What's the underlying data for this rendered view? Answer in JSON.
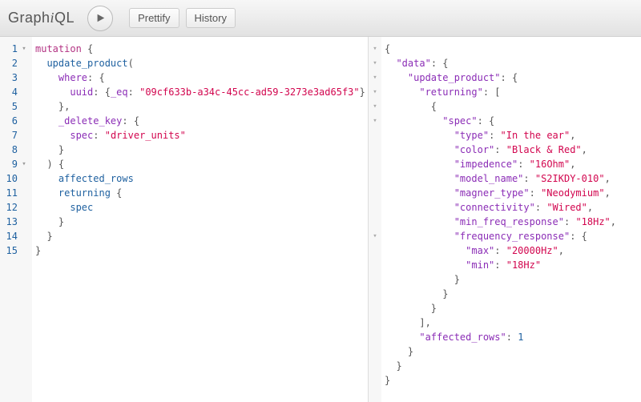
{
  "topbar": {
    "prettify_label": "Prettify",
    "history_label": "History"
  },
  "query": {
    "lines": [
      {
        "num": 1,
        "fold": true,
        "tokens": [
          [
            "kw",
            "mutation"
          ],
          [
            "plain",
            " "
          ],
          [
            "punc",
            "{"
          ]
        ]
      },
      {
        "num": 2,
        "fold": false,
        "tokens": [
          [
            "plain",
            "  "
          ],
          [
            "prop",
            "update_product"
          ],
          [
            "punc",
            "("
          ]
        ]
      },
      {
        "num": 3,
        "fold": false,
        "tokens": [
          [
            "plain",
            "    "
          ],
          [
            "attr",
            "where"
          ],
          [
            "punc",
            ": {"
          ]
        ]
      },
      {
        "num": 4,
        "fold": false,
        "tokens": [
          [
            "plain",
            "      "
          ],
          [
            "attr",
            "uuid"
          ],
          [
            "punc",
            ": {"
          ],
          [
            "attr",
            "_eq"
          ],
          [
            "punc",
            ": "
          ],
          [
            "str",
            "\"09cf633b-a34c-45cc-ad59-3273e3ad65f3\""
          ],
          [
            "punc",
            "}"
          ]
        ]
      },
      {
        "num": 5,
        "fold": false,
        "tokens": [
          [
            "plain",
            "    "
          ],
          [
            "punc",
            "},"
          ]
        ]
      },
      {
        "num": 6,
        "fold": false,
        "tokens": [
          [
            "plain",
            "    "
          ],
          [
            "attr",
            "_delete_key"
          ],
          [
            "punc",
            ": {"
          ]
        ]
      },
      {
        "num": 7,
        "fold": false,
        "tokens": [
          [
            "plain",
            "      "
          ],
          [
            "attr",
            "spec"
          ],
          [
            "punc",
            ": "
          ],
          [
            "str",
            "\"driver_units\""
          ]
        ]
      },
      {
        "num": 8,
        "fold": false,
        "tokens": [
          [
            "plain",
            "    "
          ],
          [
            "punc",
            "}"
          ]
        ]
      },
      {
        "num": 9,
        "fold": true,
        "tokens": [
          [
            "plain",
            "  "
          ],
          [
            "punc",
            ") {"
          ]
        ]
      },
      {
        "num": 10,
        "fold": false,
        "tokens": [
          [
            "plain",
            "    "
          ],
          [
            "prop",
            "affected_rows"
          ]
        ]
      },
      {
        "num": 11,
        "fold": false,
        "tokens": [
          [
            "plain",
            "    "
          ],
          [
            "prop",
            "returning"
          ],
          [
            "plain",
            " "
          ],
          [
            "punc",
            "{"
          ]
        ]
      },
      {
        "num": 12,
        "fold": false,
        "tokens": [
          [
            "plain",
            "      "
          ],
          [
            "prop",
            "spec"
          ]
        ]
      },
      {
        "num": 13,
        "fold": false,
        "tokens": [
          [
            "plain",
            "    "
          ],
          [
            "punc",
            "}"
          ]
        ]
      },
      {
        "num": 14,
        "fold": false,
        "tokens": [
          [
            "plain",
            "  "
          ],
          [
            "punc",
            "}"
          ]
        ]
      },
      {
        "num": 15,
        "fold": false,
        "tokens": [
          [
            "punc",
            "}"
          ]
        ]
      }
    ]
  },
  "result": {
    "lines": [
      {
        "fold": true,
        "tokens": [
          [
            "punc",
            "{"
          ]
        ]
      },
      {
        "fold": true,
        "tokens": [
          [
            "plain",
            "  "
          ],
          [
            "key",
            "\"data\""
          ],
          [
            "punc",
            ": {"
          ]
        ]
      },
      {
        "fold": true,
        "tokens": [
          [
            "plain",
            "    "
          ],
          [
            "key",
            "\"update_product\""
          ],
          [
            "punc",
            ": {"
          ]
        ]
      },
      {
        "fold": true,
        "tokens": [
          [
            "plain",
            "      "
          ],
          [
            "key",
            "\"returning\""
          ],
          [
            "punc",
            ": ["
          ]
        ]
      },
      {
        "fold": true,
        "tokens": [
          [
            "plain",
            "        "
          ],
          [
            "punc",
            "{"
          ]
        ]
      },
      {
        "fold": true,
        "tokens": [
          [
            "plain",
            "          "
          ],
          [
            "key",
            "\"spec\""
          ],
          [
            "punc",
            ": {"
          ]
        ]
      },
      {
        "fold": false,
        "tokens": [
          [
            "plain",
            "            "
          ],
          [
            "key",
            "\"type\""
          ],
          [
            "punc",
            ": "
          ],
          [
            "rstr",
            "\"In the ear\""
          ],
          [
            "punc",
            ","
          ]
        ]
      },
      {
        "fold": false,
        "tokens": [
          [
            "plain",
            "            "
          ],
          [
            "key",
            "\"color\""
          ],
          [
            "punc",
            ": "
          ],
          [
            "rstr",
            "\"Black & Red\""
          ],
          [
            "punc",
            ","
          ]
        ]
      },
      {
        "fold": false,
        "tokens": [
          [
            "plain",
            "            "
          ],
          [
            "key",
            "\"impedence\""
          ],
          [
            "punc",
            ": "
          ],
          [
            "rstr",
            "\"16Ohm\""
          ],
          [
            "punc",
            ","
          ]
        ]
      },
      {
        "fold": false,
        "tokens": [
          [
            "plain",
            "            "
          ],
          [
            "key",
            "\"model_name\""
          ],
          [
            "punc",
            ": "
          ],
          [
            "rstr",
            "\"S2IKDY-010\""
          ],
          [
            "punc",
            ","
          ]
        ]
      },
      {
        "fold": false,
        "tokens": [
          [
            "plain",
            "            "
          ],
          [
            "key",
            "\"magner_type\""
          ],
          [
            "punc",
            ": "
          ],
          [
            "rstr",
            "\"Neodymium\""
          ],
          [
            "punc",
            ","
          ]
        ]
      },
      {
        "fold": false,
        "tokens": [
          [
            "plain",
            "            "
          ],
          [
            "key",
            "\"connectivity\""
          ],
          [
            "punc",
            ": "
          ],
          [
            "rstr",
            "\"Wired\""
          ],
          [
            "punc",
            ","
          ]
        ]
      },
      {
        "fold": false,
        "tokens": [
          [
            "plain",
            "            "
          ],
          [
            "key",
            "\"min_freq_response\""
          ],
          [
            "punc",
            ": "
          ],
          [
            "rstr",
            "\"18Hz\""
          ],
          [
            "punc",
            ","
          ]
        ]
      },
      {
        "fold": true,
        "tokens": [
          [
            "plain",
            "            "
          ],
          [
            "key",
            "\"frequency_response\""
          ],
          [
            "punc",
            ": {"
          ]
        ]
      },
      {
        "fold": false,
        "tokens": [
          [
            "plain",
            "              "
          ],
          [
            "key",
            "\"max\""
          ],
          [
            "punc",
            ": "
          ],
          [
            "rstr",
            "\"20000Hz\""
          ],
          [
            "punc",
            ","
          ]
        ]
      },
      {
        "fold": false,
        "tokens": [
          [
            "plain",
            "              "
          ],
          [
            "key",
            "\"min\""
          ],
          [
            "punc",
            ": "
          ],
          [
            "rstr",
            "\"18Hz\""
          ]
        ]
      },
      {
        "fold": false,
        "tokens": [
          [
            "plain",
            "            "
          ],
          [
            "punc",
            "}"
          ]
        ]
      },
      {
        "fold": false,
        "tokens": [
          [
            "plain",
            "          "
          ],
          [
            "punc",
            "}"
          ]
        ]
      },
      {
        "fold": false,
        "tokens": [
          [
            "plain",
            "        "
          ],
          [
            "punc",
            "}"
          ]
        ]
      },
      {
        "fold": false,
        "tokens": [
          [
            "plain",
            "      "
          ],
          [
            "punc",
            "],"
          ]
        ]
      },
      {
        "fold": false,
        "tokens": [
          [
            "plain",
            "      "
          ],
          [
            "key",
            "\"affected_rows\""
          ],
          [
            "punc",
            ": "
          ],
          [
            "rnum",
            "1"
          ]
        ]
      },
      {
        "fold": false,
        "tokens": [
          [
            "plain",
            "    "
          ],
          [
            "punc",
            "}"
          ]
        ]
      },
      {
        "fold": false,
        "tokens": [
          [
            "plain",
            "  "
          ],
          [
            "punc",
            "}"
          ]
        ]
      },
      {
        "fold": false,
        "tokens": [
          [
            "punc",
            "}"
          ]
        ]
      }
    ]
  }
}
